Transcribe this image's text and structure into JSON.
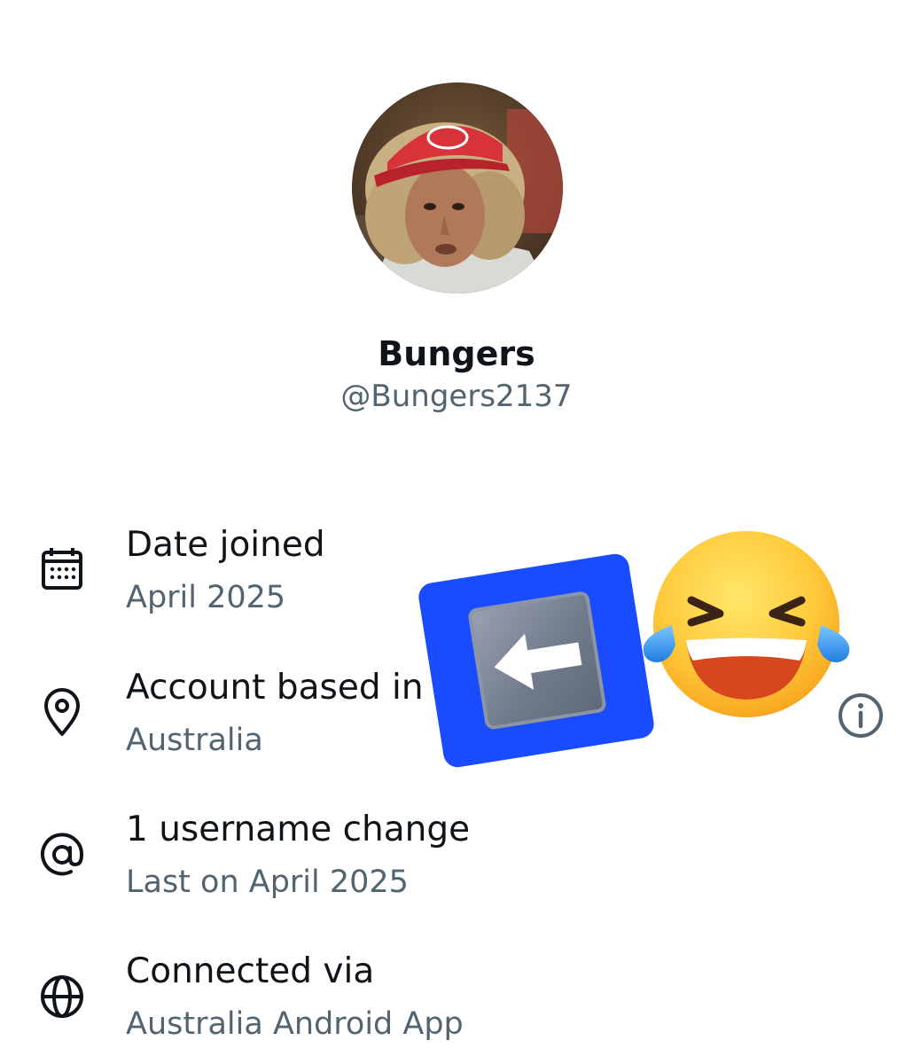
{
  "profile": {
    "display_name": "Bungers",
    "handle": "@Bungers2137",
    "avatar_icon": "profile-photo"
  },
  "about_rows": [
    {
      "icon": "calendar-icon",
      "title": "Date joined",
      "subtitle": "April 2025"
    },
    {
      "icon": "location-pin-icon",
      "title": "Account based in",
      "subtitle": "Australia"
    },
    {
      "icon": "at-sign-icon",
      "title": "1 username change",
      "subtitle": "Last on April 2025"
    },
    {
      "icon": "globe-icon",
      "title": "Connected via",
      "subtitle": "Australia Android App"
    }
  ],
  "info_button_icon": "info-icon",
  "stickers": [
    "left-arrow-key-emoji",
    "tears-of-joy-emoji"
  ],
  "colors": {
    "primary_text": "#0f1419",
    "secondary_text": "#536471",
    "sticker_blue": "#1a4cff"
  }
}
